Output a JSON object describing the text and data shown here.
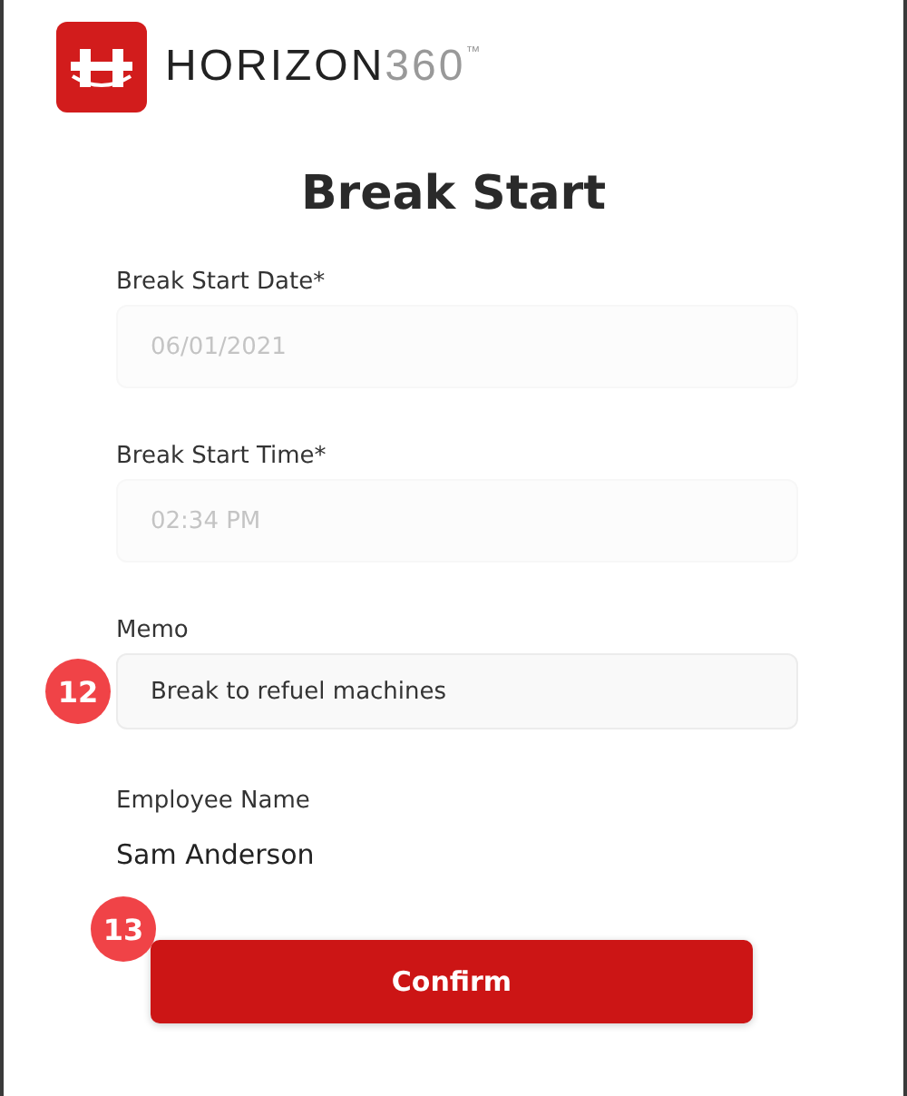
{
  "logo": {
    "word": "HORIZON",
    "number": "360",
    "mark": "™"
  },
  "title": "Break Start",
  "fields": [
    {
      "label": "Break Start Date*",
      "value": "06/01/2021",
      "disabled": true
    },
    {
      "label": "Break Start Time*",
      "value": "02:34 PM",
      "disabled": true
    },
    {
      "label": "Memo",
      "value": "Break to refuel machines",
      "disabled": false,
      "badge": "12"
    }
  ],
  "employee": {
    "label": "Employee Name",
    "value": "Sam Anderson"
  },
  "confirm": {
    "label": "Confirm",
    "badge": "13"
  }
}
